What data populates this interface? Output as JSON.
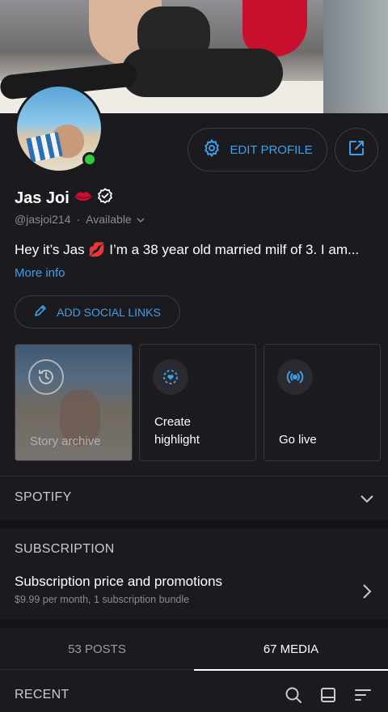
{
  "profile": {
    "name": "Jas Joi",
    "handle": "@jasjoi214",
    "separator": "·",
    "status": "Available",
    "bio": "Hey it’s Jas 💋 I’m a 38 year old married milf of 3. I am...",
    "more_info": "More info"
  },
  "actions": {
    "edit_profile": "EDIT PROFILE",
    "add_social_links": "ADD SOCIAL LINKS"
  },
  "cards": {
    "story_archive": "Story archive",
    "create_highlight_line1": "Create",
    "create_highlight_line2": "highlight",
    "go_live": "Go live"
  },
  "sections": {
    "spotify": "SPOTIFY",
    "subscription": "SUBSCRIPTION",
    "subscription_title": "Subscription price and promotions",
    "subscription_detail": "$9.99 per month, 1 subscription bundle"
  },
  "tabs": {
    "posts": "53 POSTS",
    "media": "67 MEDIA"
  },
  "feed": {
    "recent": "RECENT"
  },
  "colors": {
    "background": "#1b1b1f",
    "accent": "#3d9fe6",
    "online": "#2ecc40",
    "kiss": "#c8102e"
  },
  "icons": {
    "edit": "gear-icon",
    "share": "share-icon",
    "verified": "verified-badge-icon",
    "kiss": "lips-emoji-icon",
    "pencil": "pencil-icon",
    "archive": "clock-history-icon",
    "highlight": "highlight-heart-icon",
    "live": "broadcast-icon",
    "search": "search-icon",
    "layout": "grid-view-icon",
    "sort": "sort-icon"
  }
}
